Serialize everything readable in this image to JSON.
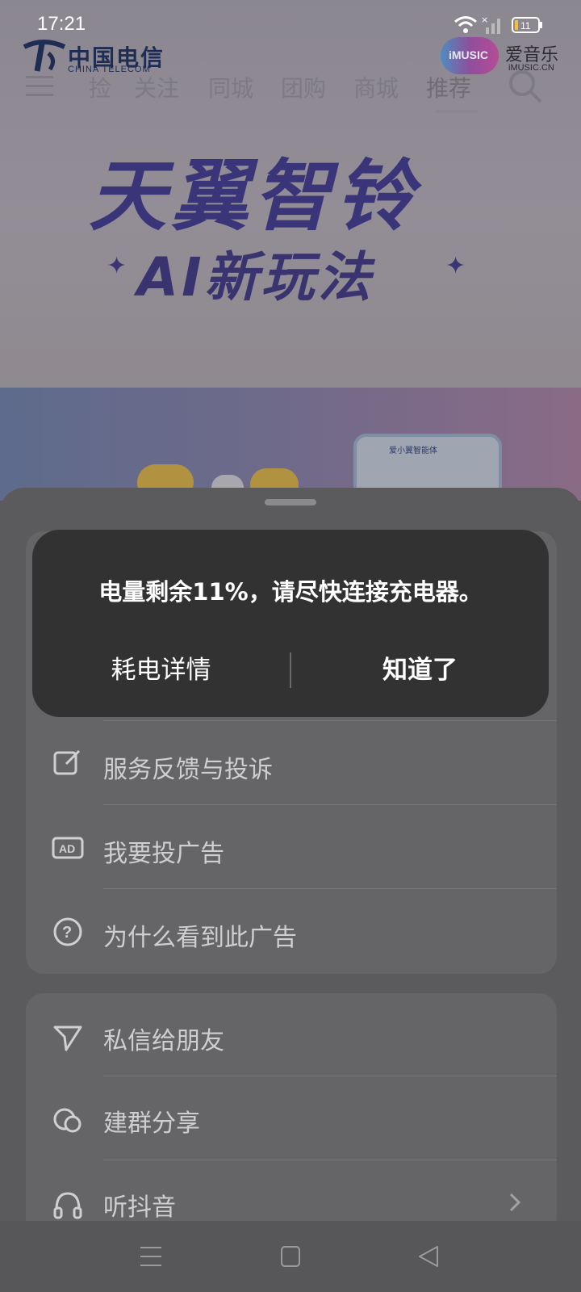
{
  "status_bar": {
    "time": "17:21",
    "battery_level": "11"
  },
  "header": {
    "operator_name": "中国电信",
    "operator_en": "CHINA TELECOM",
    "partner_badge": "iMUSIC",
    "partner_name": "爱音乐",
    "partner_domain": "iMUSIC.CN",
    "tabs": [
      "捡",
      "关注",
      "同城",
      "团购",
      "商城",
      "推荐"
    ],
    "active_tab": "推荐"
  },
  "banner": {
    "title": "天翼智铃",
    "subtitle": "AI新玩法",
    "phone_mock_title": "爱小翼智能体"
  },
  "sheet": {
    "group1": [
      {
        "label": "服务反馈与投诉",
        "icon": "edit-icon"
      },
      {
        "label": "我要投广告",
        "icon": "ad-icon"
      },
      {
        "label": "为什么看到此广告",
        "icon": "help-icon"
      }
    ],
    "group2": [
      {
        "label": "私信给朋友",
        "icon": "send-icon"
      },
      {
        "label": "建群分享",
        "icon": "group-chat-icon"
      },
      {
        "label": "听抖音",
        "icon": "headphones-icon"
      }
    ]
  },
  "toast": {
    "message": "电量剩余11%，请尽快连接充电器。",
    "details_label": "耗电详情",
    "ok_label": "知道了"
  },
  "colors": {
    "dialog_bg": "#323232",
    "sheet_bg": "#5b5b5d",
    "banner_text": "#3a3478"
  }
}
